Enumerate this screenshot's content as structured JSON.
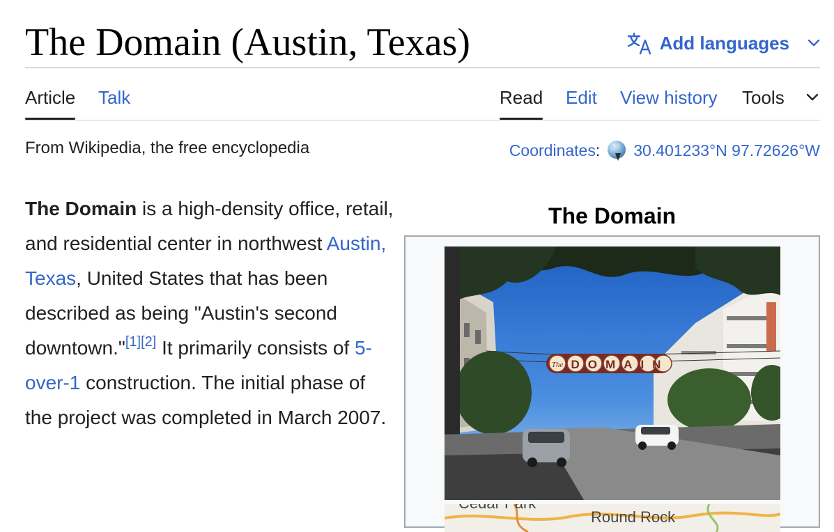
{
  "page": {
    "title": "The Domain (Austin, Texas)",
    "add_languages": "Add languages"
  },
  "tabs": {
    "article": "Article",
    "talk": "Talk",
    "read": "Read",
    "edit": "Edit",
    "view_history": "View history",
    "tools": "Tools"
  },
  "tagline": "From Wikipedia, the free encyclopedia",
  "coordinates": {
    "label": "Coordinates",
    "value": "30.401233°N 97.72626°W"
  },
  "article": {
    "subject": "The Domain",
    "text_1": " is a high-density office, retail, and residential center in northwest ",
    "link_austin": "Austin, Texas",
    "text_2": ", United States that has been described as being \"Austin's second downtown.\"",
    "ref_1": "[1]",
    "ref_2": "[2]",
    "text_3": " It primarily consists of ",
    "link_5over1": "5-over-1",
    "text_4": " construction. The initial phase of the project was completed in March 2007."
  },
  "infobox": {
    "caption": "The Domain",
    "sign_text": "DOMAIN",
    "sign_script": "The",
    "map_label_1": "Cedar Park",
    "map_label_2": "Round Rock"
  },
  "colors": {
    "link": "#3366cc",
    "text": "#202122",
    "rule": "#a2a9b1",
    "infobox_bg": "#f8f9fa",
    "sky": "#2f74d0"
  },
  "icons": {
    "language": "translate-icon",
    "chevron": "chevron-down-icon",
    "globe": "globe-icon"
  }
}
